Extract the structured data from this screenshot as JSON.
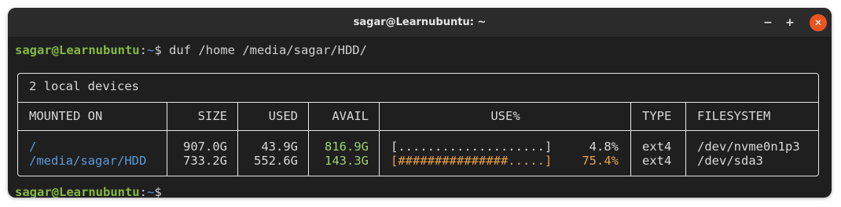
{
  "window": {
    "title": "sagar@Learnubuntu: ~",
    "minimize_glyph": "−",
    "maximize_glyph": "+",
    "close_glyph": "✕"
  },
  "terminal": {
    "prompt_user": "sagar@Learnubuntu",
    "prompt_sep": ":",
    "prompt_path": "~",
    "prompt_symbol": "$",
    "command": " duf /home /media/sagar/HDD/"
  },
  "table": {
    "header": "2 local devices",
    "columns": [
      "MOUNTED ON",
      "SIZE",
      "USED",
      "AVAIL",
      "USE%",
      "TYPE",
      "FILESYSTEM"
    ],
    "rows": [
      {
        "mounted_on": "/",
        "size": "907.0G",
        "used": "43.9G",
        "avail": "816.9G",
        "use_bar": "[....................]",
        "use_pct": "4.8%",
        "type": "ext4",
        "filesystem": "/dev/nvme0n1p3"
      },
      {
        "mounted_on": "/media/sagar/HDD",
        "size": "733.2G",
        "used": "552.6G",
        "avail": "143.3G",
        "use_bar": "[###############.....]",
        "use_pct": "75.4%",
        "type": "ext4",
        "filesystem": "/dev/sda3"
      }
    ]
  },
  "colors": {
    "prompt_user": "#86b843",
    "prompt_path": "#5b8fd6",
    "mount": "#5b9bd8",
    "avail": "#9fcf6f",
    "usage_warn": "#e6a04c",
    "close_button": "#e95420"
  }
}
